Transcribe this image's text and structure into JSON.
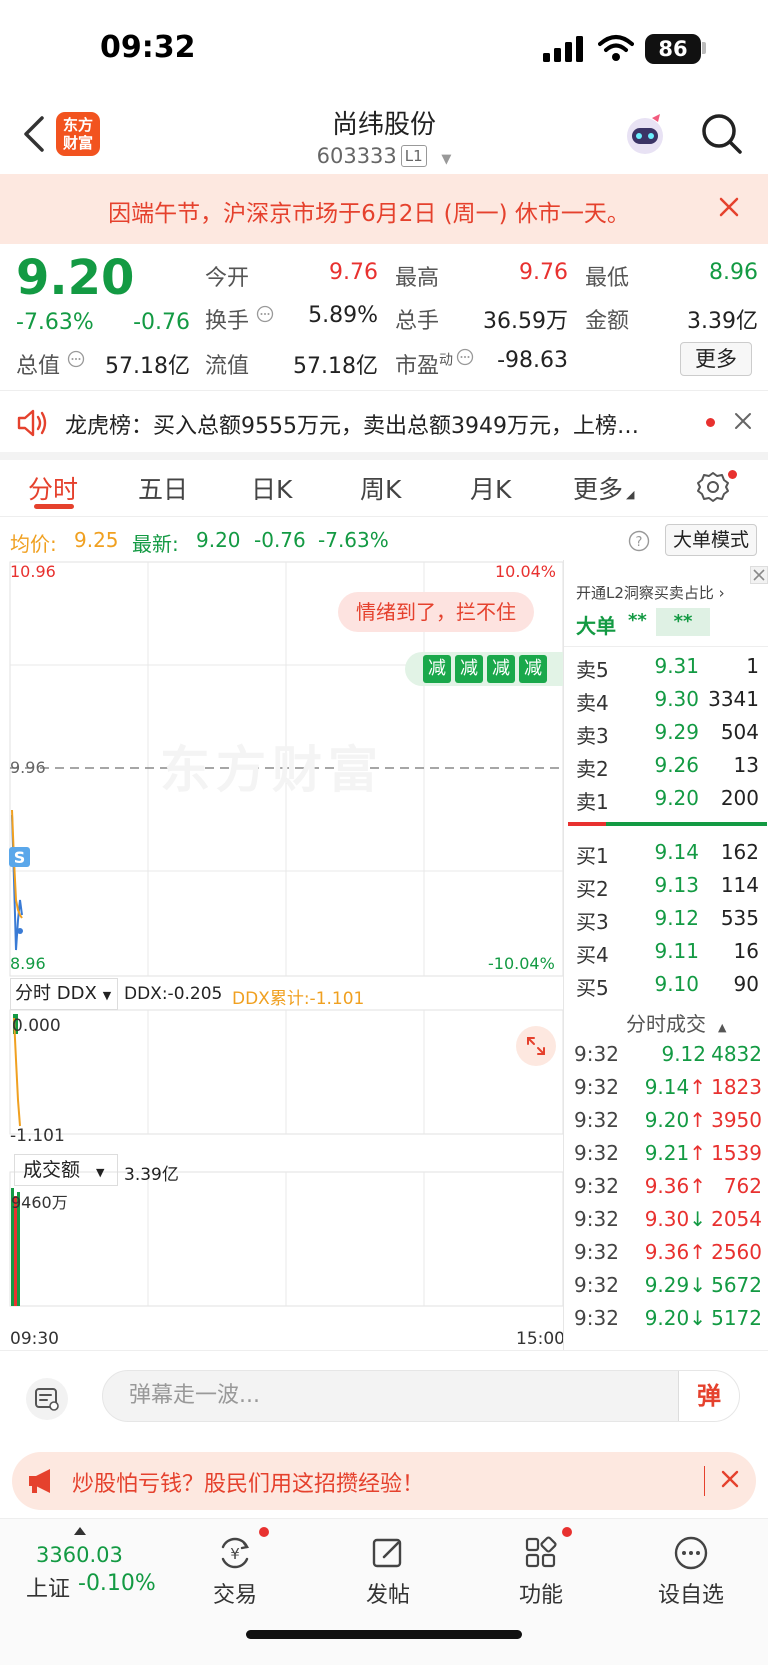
{
  "status": {
    "time": "09:32",
    "battery": "86"
  },
  "header": {
    "logo_line1": "东方",
    "logo_line2": "财富",
    "name": "尚纬股份",
    "code": "603333",
    "level": "L1"
  },
  "banner": {
    "text": "因端午节，沪深京市场于6月2日 (周一) 休市一天。"
  },
  "quote": {
    "price": "9.20",
    "pct": "-7.63%",
    "chg": "-0.76",
    "total_val_label": "总值",
    "total_val": "57.18亿",
    "fields": [
      {
        "label": "今开",
        "value": "9.76",
        "color": "red"
      },
      {
        "label": "最高",
        "value": "9.76",
        "color": "red"
      },
      {
        "label": "最低",
        "value": "8.96",
        "color": "green"
      },
      {
        "label": "换手",
        "value": "5.89%",
        "color": "dark"
      },
      {
        "label": "总手",
        "value": "36.59万",
        "color": "dark"
      },
      {
        "label": "金额",
        "value": "3.39亿",
        "color": "dark"
      },
      {
        "label": "流值",
        "value": "57.18亿",
        "color": "dark"
      },
      {
        "label": "市盈",
        "label_sup": "动",
        "value": "-98.63",
        "color": "dark"
      }
    ],
    "more": "更多"
  },
  "dragon": {
    "text": "龙虎榜：买入总额9555万元，卖出总额3949万元，上榜…"
  },
  "tabs": [
    "分时",
    "五日",
    "日K",
    "周K",
    "月K",
    "更多"
  ],
  "avg_row": {
    "avg_label": "均价:",
    "avg_value": "9.25",
    "latest_label": "最新:",
    "latest_value": "9.20",
    "latest_chg": "-0.76",
    "latest_pct": "-7.63%",
    "mode_button": "大单模式"
  },
  "chart": {
    "top_left": "10.96",
    "top_right": "10.04%",
    "mid": "9.96",
    "bottom_left": "8.96",
    "bottom_right": "-10.04%",
    "bubble": "情绪到了，拦不住",
    "reduce_tag": "减",
    "watermark": "东方财富",
    "s_marker": "S",
    "ddx_select": "分时 DDX",
    "ddx_value": "DDX:-0.205",
    "ddx_cum": "DDX累计:-1.101",
    "ddx_top": "0.000",
    "ddx_bottom": "-1.101",
    "volume_select": "成交额",
    "volume_total": "3.39亿",
    "volume_top": "9460万",
    "time_start": "09:30",
    "time_end": "15:00",
    "colors": {
      "up": "#e8312f",
      "down": "#139a43",
      "avg": "#f0a020",
      "price": "#3a7bd5"
    }
  },
  "book": {
    "l2_title": "开通L2洞察买卖占比 ›",
    "big_order_label": "大单",
    "big_order_v1": "**",
    "big_order_v2": "**",
    "asks": [
      {
        "label": "卖5",
        "price": "9.31",
        "vol": "1"
      },
      {
        "label": "卖4",
        "price": "9.30",
        "vol": "3341"
      },
      {
        "label": "卖3",
        "price": "9.29",
        "vol": "504"
      },
      {
        "label": "卖2",
        "price": "9.26",
        "vol": "13"
      },
      {
        "label": "卖1",
        "price": "9.20",
        "vol": "200"
      }
    ],
    "bids": [
      {
        "label": "买1",
        "price": "9.14",
        "vol": "162"
      },
      {
        "label": "买2",
        "price": "9.13",
        "vol": "114"
      },
      {
        "label": "买3",
        "price": "9.12",
        "vol": "535"
      },
      {
        "label": "买4",
        "price": "9.11",
        "vol": "16"
      },
      {
        "label": "买5",
        "price": "9.10",
        "vol": "90"
      }
    ],
    "trades_title": "分时成交",
    "trades": [
      {
        "time": "9:32",
        "price": "9.12",
        "dir": "",
        "vol": "4832",
        "side": "sell"
      },
      {
        "time": "9:32",
        "price": "9.14",
        "dir": "↑",
        "vol": "1823",
        "side": "buy"
      },
      {
        "time": "9:32",
        "price": "9.20",
        "dir": "↑",
        "vol": "3950",
        "side": "buy"
      },
      {
        "time": "9:32",
        "price": "9.21",
        "dir": "↑",
        "vol": "1539",
        "side": "buy"
      },
      {
        "time": "9:32",
        "price": "9.36",
        "dir": "↑",
        "vol": "762",
        "side": "buy"
      },
      {
        "time": "9:32",
        "price": "9.30",
        "dir": "↓",
        "vol": "2054",
        "side": "buy"
      },
      {
        "time": "9:32",
        "price": "9.36",
        "dir": "↑",
        "vol": "2560",
        "side": "buy"
      },
      {
        "time": "9:32",
        "price": "9.29",
        "dir": "↓",
        "vol": "5672",
        "side": "sell"
      },
      {
        "time": "9:32",
        "price": "9.20",
        "dir": "↓",
        "vol": "5172",
        "side": "sell"
      }
    ]
  },
  "comment": {
    "placeholder": "弹幕走一波...",
    "send": "弹"
  },
  "ad": {
    "text": "炒股怕亏钱？股民们用这招攒经验！"
  },
  "nav": {
    "index_value": "3360.03",
    "index_name": "上证",
    "index_chg": "-0.10%",
    "items": [
      "交易",
      "发帖",
      "功能",
      "设自选"
    ]
  }
}
